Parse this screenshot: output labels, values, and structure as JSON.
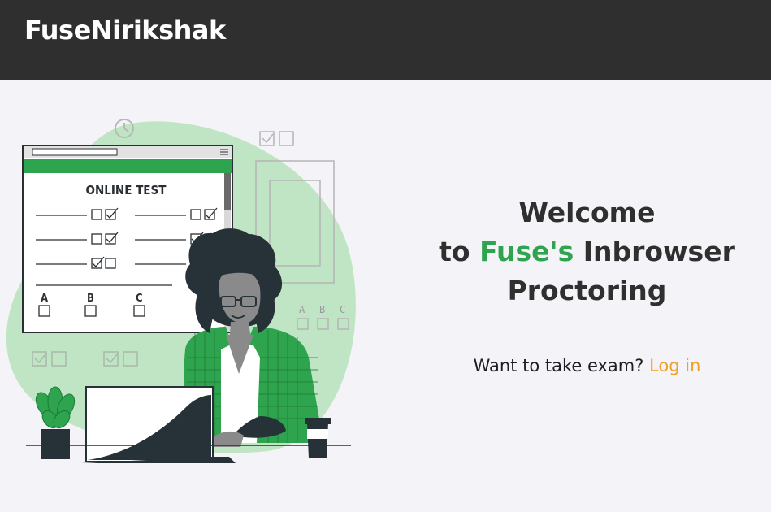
{
  "navbar": {
    "brand": "FuseNirikshak"
  },
  "illustration": {
    "test_title": "ONLINE TEST",
    "options_main": [
      "A",
      "B",
      "C"
    ],
    "options_side": [
      "A",
      "B",
      "C"
    ]
  },
  "hero": {
    "line1": "Welcome",
    "line2_prefix": "to ",
    "line2_accent": "Fuse's",
    "line2_suffix": " Inbrowser",
    "line3": "Proctoring"
  },
  "cta": {
    "prompt": "Want to take exam?",
    "login_label": "Log in"
  },
  "colors": {
    "navbar_bg": "#2f2f2f",
    "page_bg": "#f4f3f8",
    "accent_green": "#2ea44f",
    "link_orange": "#f0a02a"
  }
}
